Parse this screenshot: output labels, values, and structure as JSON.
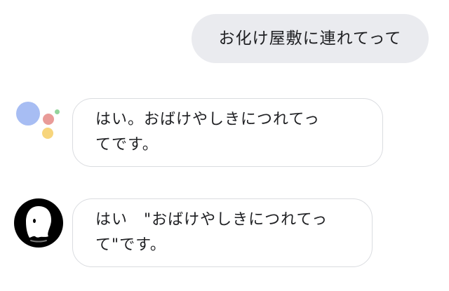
{
  "conversation": {
    "user_message": {
      "text": "お化け屋敷に連れてって"
    },
    "assistant_message": {
      "lines": [
        "はい。おばけやしきにつれてっ",
        "てです。"
      ]
    },
    "app_message": {
      "lines": [
        "はい　\"おばけやしきにつれてっ",
        "て\"です。"
      ]
    }
  },
  "avatars": {
    "assistant": {
      "icon": "google-assistant-logo-icon",
      "colors": {
        "blue": "#a7bdf3",
        "red": "#e99b98",
        "yellow": "#f7d57c",
        "green": "#93d49c"
      }
    },
    "app": {
      "icon": "ghost-icon",
      "colors": {
        "background": "#000000",
        "ghost": "#ffffff"
      }
    }
  },
  "colors": {
    "user_bubble": "#eaebef",
    "reply_bubble_border": "#dadce0",
    "text": "#202124"
  }
}
